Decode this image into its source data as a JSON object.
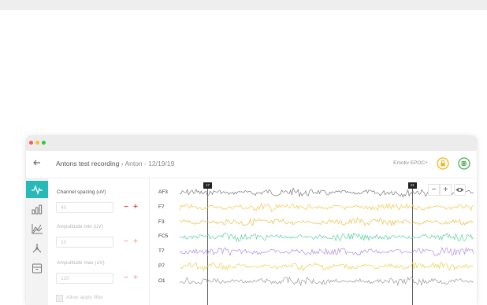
{
  "window": {
    "breadcrumb_recording": "Antons test recording",
    "breadcrumb_subject": "Anton - 12/19/19",
    "device_name": "Emotiv EPOC+"
  },
  "sidebar": {
    "items": [
      {
        "icon": "waveform-icon",
        "active": true
      },
      {
        "icon": "bar-chart-icon",
        "active": false
      },
      {
        "icon": "line-graph-icon",
        "active": false
      },
      {
        "icon": "network-icon",
        "active": false
      },
      {
        "icon": "archive-icon",
        "active": false
      }
    ]
  },
  "controls": {
    "channel_spacing_label": "Channel spacing (uV)",
    "channel_spacing_value": "40",
    "amp_min_label": "Ampulitude min (uV)",
    "amp_min_value": "10",
    "amp_max_label": "Ampulitude max (uV)",
    "amp_max_value": "120",
    "filter_label": "Allow apply filter"
  },
  "plot": {
    "channels": [
      "AF3",
      "F7",
      "F3",
      "FC5",
      "T7",
      "P7",
      "O1"
    ],
    "channel_colors": [
      "#7a7a7a",
      "#f2c84b",
      "#e8c04a",
      "#5bd0a0",
      "#b48ee8",
      "#e8d24e",
      "#9a9a9a"
    ],
    "markers": [
      "17",
      "21"
    ],
    "zoom_out_label": "−",
    "zoom_in_label": "+"
  },
  "colors": {
    "accent": "#27b8b8",
    "battery": "#4cb050",
    "lock": "#f2b418",
    "danger": "#e84545"
  }
}
